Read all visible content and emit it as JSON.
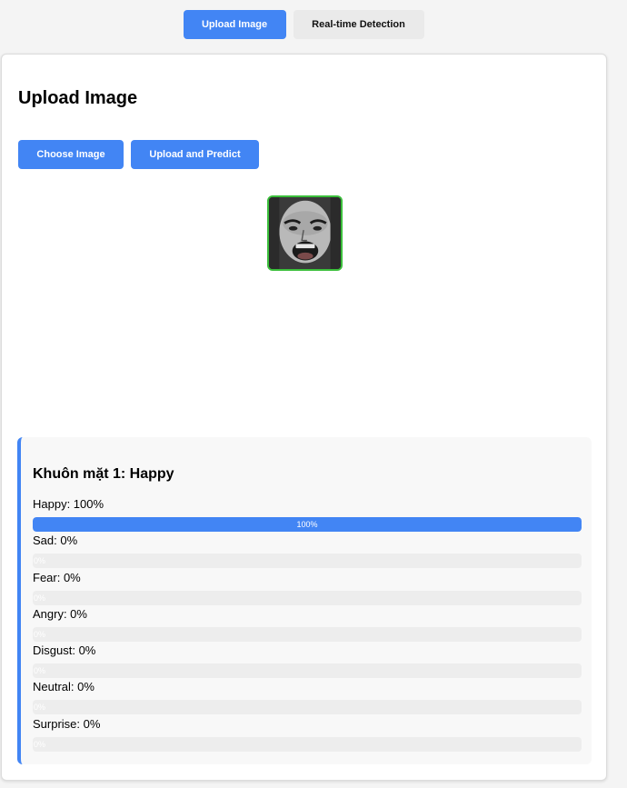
{
  "tabs": [
    {
      "label": "Upload Image",
      "active": true
    },
    {
      "label": "Real-time Detection",
      "active": false
    }
  ],
  "panel": {
    "title": "Upload Image",
    "choose_label": "Choose Image",
    "upload_label": "Upload and Predict"
  },
  "result": {
    "face_title": "Khuôn mặt 1: Happy",
    "emotions": [
      {
        "label": "Happy: 100%",
        "percent": 100,
        "bar_text": "100%"
      },
      {
        "label": "Sad: 0%",
        "percent": 0,
        "bar_text": "0%"
      },
      {
        "label": "Fear: 0%",
        "percent": 0,
        "bar_text": "0%"
      },
      {
        "label": "Angry: 0%",
        "percent": 0,
        "bar_text": "0%"
      },
      {
        "label": "Disgust: 0%",
        "percent": 0,
        "bar_text": "0%"
      },
      {
        "label": "Neutral: 0%",
        "percent": 0,
        "bar_text": "0%"
      },
      {
        "label": "Surprise: 0%",
        "percent": 0,
        "bar_text": "0%"
      }
    ]
  },
  "colors": {
    "accent": "#4285f4",
    "preview_border": "#3bbf3b"
  }
}
